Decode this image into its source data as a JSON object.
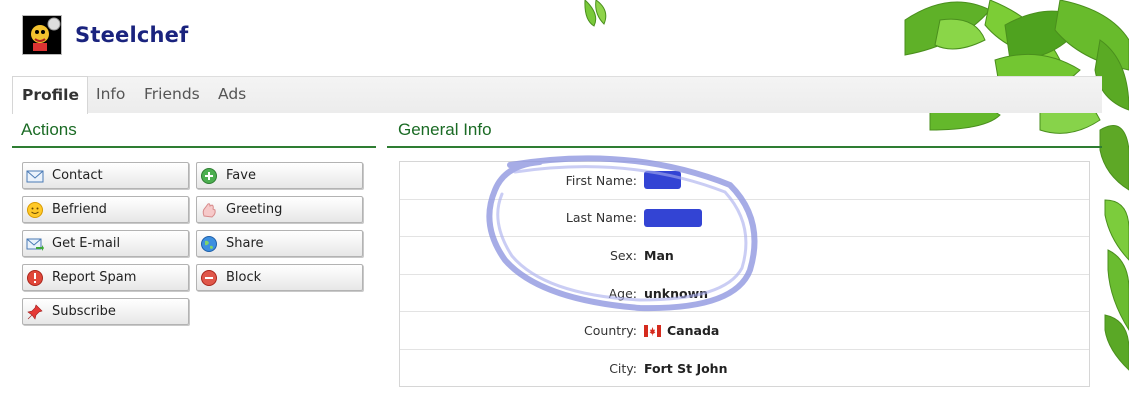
{
  "header": {
    "username": "Steelchef"
  },
  "tabs": [
    {
      "label": "Profile"
    },
    {
      "label": "Info"
    },
    {
      "label": "Friends"
    },
    {
      "label": "Ads"
    }
  ],
  "actions": {
    "title": "Actions",
    "buttons": [
      {
        "label": "Contact",
        "icon": "envelope-icon"
      },
      {
        "label": "Fave",
        "icon": "plus-circle-icon"
      },
      {
        "label": "Befriend",
        "icon": "smiley-icon"
      },
      {
        "label": "Greeting",
        "icon": "hand-icon"
      },
      {
        "label": "Get E-mail",
        "icon": "email-arrow-icon"
      },
      {
        "label": "Share",
        "icon": "globe-icon"
      },
      {
        "label": "Report Spam",
        "icon": "warning-icon"
      },
      {
        "label": "Block",
        "icon": "minus-circle-icon"
      },
      {
        "label": "Subscribe",
        "icon": "pin-icon"
      }
    ]
  },
  "general_info": {
    "title": "General Info",
    "rows": [
      {
        "label": "First Name:",
        "value": ""
      },
      {
        "label": "Last Name:",
        "value": ""
      },
      {
        "label": "Sex:",
        "value": "Man"
      },
      {
        "label": "Age:",
        "value": "unknown"
      },
      {
        "label": "Country:",
        "value": "Canada"
      },
      {
        "label": "City:",
        "value": "Fort St John"
      }
    ]
  },
  "colors": {
    "username": "#1a237e",
    "section_title": "#1b6b25",
    "redaction": "#3344d4",
    "scribble": "#8890dd"
  }
}
